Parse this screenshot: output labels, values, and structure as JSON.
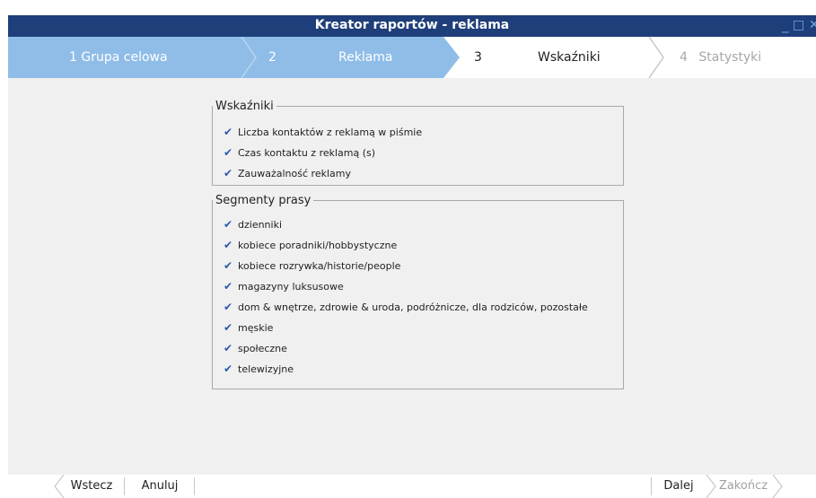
{
  "window": {
    "title": "Kreator raportów - reklama",
    "minimize_glyph": "_",
    "maximize_glyph": "□",
    "close_glyph": "✕"
  },
  "steps": [
    {
      "num": "1",
      "label": "Grupa celowa",
      "state": "done"
    },
    {
      "num": "2",
      "label": "Reklama",
      "state": "done"
    },
    {
      "num": "3",
      "label": "Wskaźniki",
      "state": "active"
    },
    {
      "num": "4",
      "label": "Statystyki",
      "state": "disabled"
    }
  ],
  "indicators": {
    "legend": "Wskaźniki",
    "items": [
      {
        "label": "Liczba kontaktów z reklamą w piśmie",
        "checked": true
      },
      {
        "label": "Czas kontaktu z reklamą (s)",
        "checked": true
      },
      {
        "label": "Zauważalność reklamy",
        "checked": true
      }
    ]
  },
  "segments": {
    "legend": "Segmenty prasy",
    "items": [
      {
        "label": "dzienniki",
        "checked": true
      },
      {
        "label": "kobiece poradniki/hobbystyczne",
        "checked": true
      },
      {
        "label": "kobiece rozrywka/historie/people",
        "checked": true
      },
      {
        "label": "magazyny luksusowe",
        "checked": true
      },
      {
        "label": "dom & wnętrze, zdrowie & uroda, podróżnicze, dla rodziców, pozostałe",
        "checked": true
      },
      {
        "label": "męskie",
        "checked": true
      },
      {
        "label": "społeczne",
        "checked": true
      },
      {
        "label": "telewizyjne",
        "checked": true
      }
    ]
  },
  "footer": {
    "back": "Wstecz",
    "cancel": "Anuluj",
    "next": "Dalej",
    "finish": "Zakończ"
  },
  "colors": {
    "titlebar": "#1f3f7a",
    "step_done": "#8fbde8",
    "step_active": "#ffffff",
    "check": "#2a5aa8",
    "content_bg": "#f0f0f0"
  }
}
